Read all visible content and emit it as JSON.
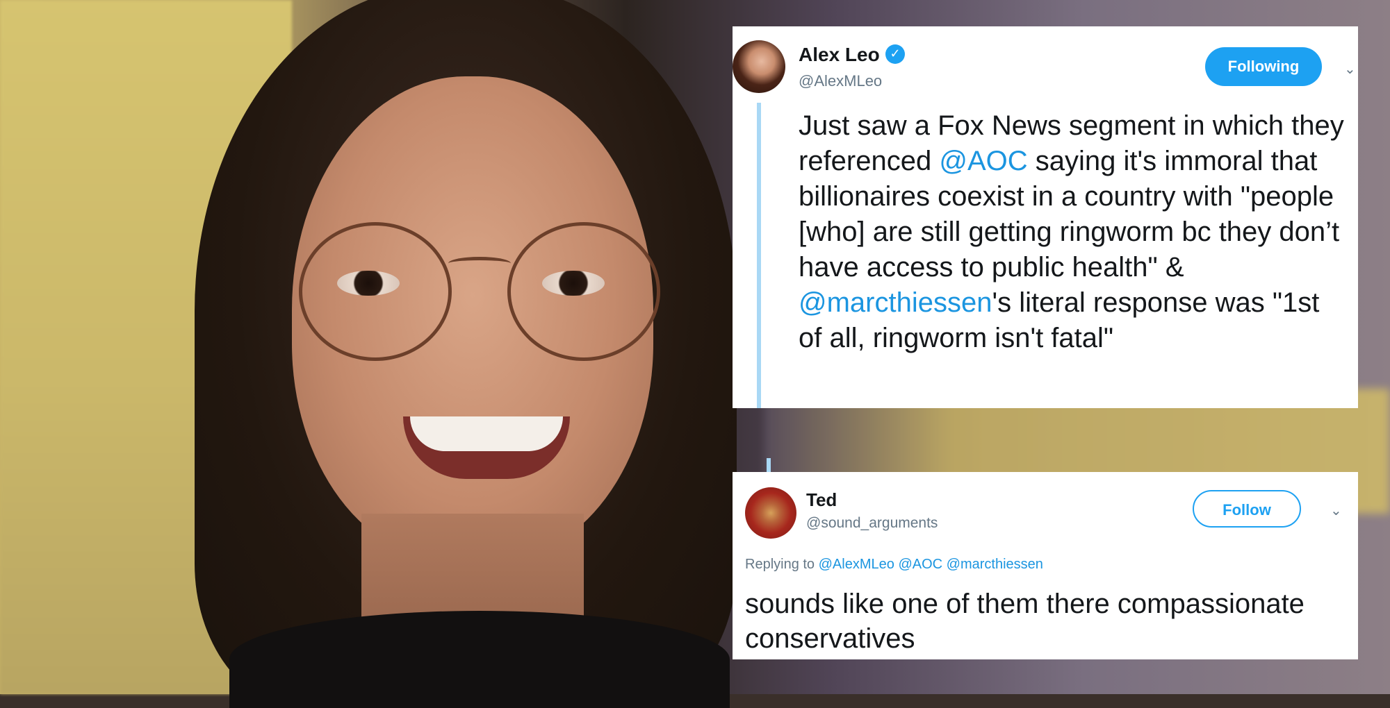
{
  "tweet": {
    "author_name": "Alex Leo",
    "author_handle": "@AlexMLeo",
    "follow_state": "Following",
    "text_parts": [
      "Just saw a Fox News segment in which they referenced ",
      "@AOC",
      " saying it's immoral that billionaires coexist in a country with \"people [who] are still getting ringworm bc they don’t have access to public health\" & ",
      "@marcthiessen",
      "'s literal response was \"1st of all, ringworm isn't fatal\""
    ]
  },
  "reply": {
    "author_name": "Ted",
    "author_handle": "@sound_arguments",
    "follow_state": "Follow",
    "replying_label": "Replying to",
    "replying_mentions": [
      "@AlexMLeo",
      "@AOC",
      "@marcthiessen"
    ],
    "text": "sounds like one of them there compassionate conservatives"
  },
  "icons": {
    "verified": "verified-badge-icon",
    "more": "chevron-down-icon"
  },
  "colors": {
    "twitter_blue": "#1da1f2",
    "mention_blue": "#1b95e0",
    "muted_gray": "#657786"
  }
}
